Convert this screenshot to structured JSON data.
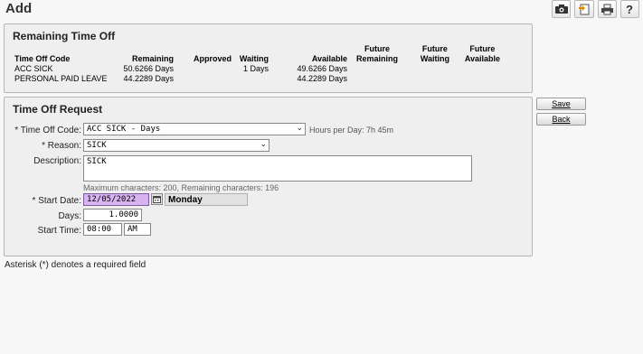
{
  "page": {
    "title": "Add"
  },
  "toolbar": {
    "icons": [
      "camera-icon",
      "export-icon",
      "print-icon",
      "help-icon"
    ]
  },
  "remaining_time_off": {
    "title": "Remaining Time Off",
    "headers": {
      "code": "Time Off Code",
      "remaining": "Remaining",
      "approved": "Approved",
      "waiting": "Waiting",
      "available": "Available",
      "future_remaining": [
        "Future",
        "Remaining"
      ],
      "future_waiting": [
        "Future",
        "Waiting"
      ],
      "future_available": [
        "Future",
        "Available"
      ]
    },
    "rows": [
      {
        "code": "ACC SICK",
        "remaining": "50.6266 Days",
        "approved": "",
        "waiting": "1 Days",
        "available": "49.6266 Days",
        "future_remaining": "",
        "future_waiting": "",
        "future_available": ""
      },
      {
        "code": "PERSONAL PAID LEAVE",
        "remaining": "44.2289 Days",
        "approved": "",
        "waiting": "",
        "available": "44.2289 Days",
        "future_remaining": "",
        "future_waiting": "",
        "future_available": ""
      }
    ]
  },
  "time_off_request": {
    "title": "Time Off Request",
    "time_off_code": {
      "label": "* Time Off Code:",
      "value": "ACC SICK - Days",
      "hint": "Hours per Day: 7h 45m"
    },
    "reason": {
      "label": "* Reason:",
      "value": "SICK"
    },
    "description": {
      "label": "Description:",
      "value": "SICK",
      "hint": "Maximum characters: 200, Remaining characters: 196"
    },
    "start_date": {
      "label": "* Start Date:",
      "value": "12/05/2022",
      "day_of_week": "Monday"
    },
    "days": {
      "label": "Days:",
      "value": "1.0000"
    },
    "start_time": {
      "label": "Start Time:",
      "value": "08:00",
      "ampm": "AM"
    }
  },
  "actions": {
    "save_label": "Save",
    "back_label": "Back"
  },
  "footer": {
    "note": "Asterisk (*) denotes a required field"
  }
}
